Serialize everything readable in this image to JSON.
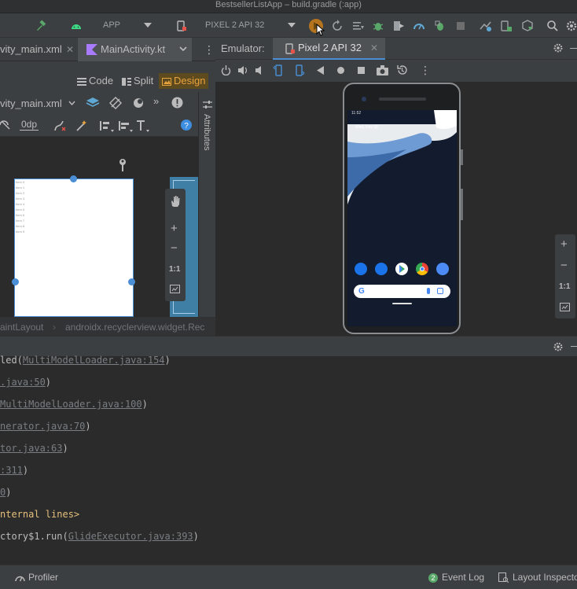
{
  "window": {
    "title": "BestsellerListApp – build.gradle (:app)"
  },
  "toolbar": {
    "run_config": "APP",
    "device": "PIXEL 2 API 32"
  },
  "editor_tabs": [
    {
      "label": "activity_main.xml",
      "shown_text": "vity_main.xml"
    },
    {
      "label": "MainActivity.kt",
      "shown_text": "MainActivity.kt"
    }
  ],
  "modes": {
    "code": "Code",
    "split": "Split",
    "design": "Design"
  },
  "design": {
    "file_selector": "vity_main.xml",
    "margin_value": "0dp",
    "list_items": [
      "Item 0",
      "Item 1",
      "Item 2",
      "Item 3",
      "Item 4",
      "Item 5",
      "Item 6",
      "Item 7",
      "Item 8",
      "Item 9"
    ],
    "zoom_fit_label": "1:1"
  },
  "attributes_label": "Attributes",
  "breadcrumb": {
    "left": "aintLayout",
    "right": "androidx.recyclerview.widget.Rec"
  },
  "emulator": {
    "label": "Emulator:",
    "tab": "Pixel 2 API 32",
    "zoom_fit_label": "1:1",
    "status_time": "11:52",
    "date_text": "Wed, Nov 16"
  },
  "console": {
    "lines": [
      {
        "pre": "led(",
        "link": "MultiModelLoader.java:154",
        "post": ")",
        "style": ""
      },
      {
        "pre": "",
        "link": ".java:50",
        "post": ")",
        "style": ""
      },
      {
        "pre": "",
        "link": "MultiModelLoader.java:100",
        "post": ")",
        "style": ""
      },
      {
        "pre": "",
        "link": "nerator.java:70",
        "post": ")",
        "style": ""
      },
      {
        "pre": "",
        "link": "tor.java:63",
        "post": ")",
        "style": ""
      },
      {
        "pre": "",
        "link": ":311",
        "post": ")",
        "style": ""
      },
      {
        "pre": "",
        "link": "0",
        "post": ")",
        "style": ""
      },
      {
        "pre": "nternal lines>",
        "link": "",
        "post": "",
        "style": "yellow"
      },
      {
        "pre": "ctory$1.run(",
        "link": "GlideExecutor.java:393",
        "post": ")",
        "style": ""
      }
    ]
  },
  "statusbar": {
    "profiler": "Profiler",
    "event_log_count": "2",
    "event_log": "Event Log",
    "layout_inspector": "Layout Inspector"
  },
  "colors": {
    "accent_design": "#e8a33d",
    "run_green": "#59a869",
    "link_blue": "#4a8fd6"
  }
}
